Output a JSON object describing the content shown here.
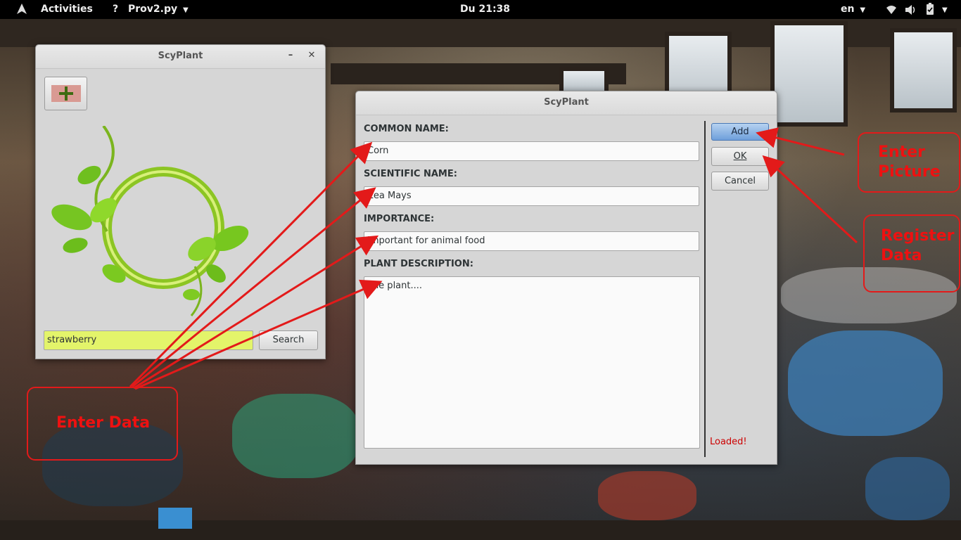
{
  "topbar": {
    "activities": "Activities",
    "app_menu": "Prov2.py",
    "clock": "Du 21:38",
    "language": "en"
  },
  "main_window": {
    "title": "ScyPlant",
    "search_value": "strawberry",
    "search_button": "Search"
  },
  "dialog": {
    "title": "ScyPlant",
    "labels": {
      "common_name": "COMMON NAME:",
      "scientific_name": "SCIENTIFIC NAME:",
      "importance": "IMPORTANCE:",
      "description": "PLANT DESCRIPTION:"
    },
    "values": {
      "common_name": "Corn",
      "scientific_name": "Zea Mays",
      "importance": "Important for animal food",
      "description": "The plant...."
    },
    "buttons": {
      "add": "Add",
      "ok": "OK",
      "cancel": "Cancel"
    },
    "status": "Loaded!"
  },
  "annotations": {
    "enter_data": "Enter Data",
    "enter_picture": [
      "Enter",
      "Picture"
    ],
    "register_data": [
      "Register",
      "Data"
    ]
  },
  "colors": {
    "annotation": "#e31a1a",
    "search_highlight": "#e3f46a",
    "primary_button": "#6e9fdb",
    "status_text": "#cc0000"
  }
}
